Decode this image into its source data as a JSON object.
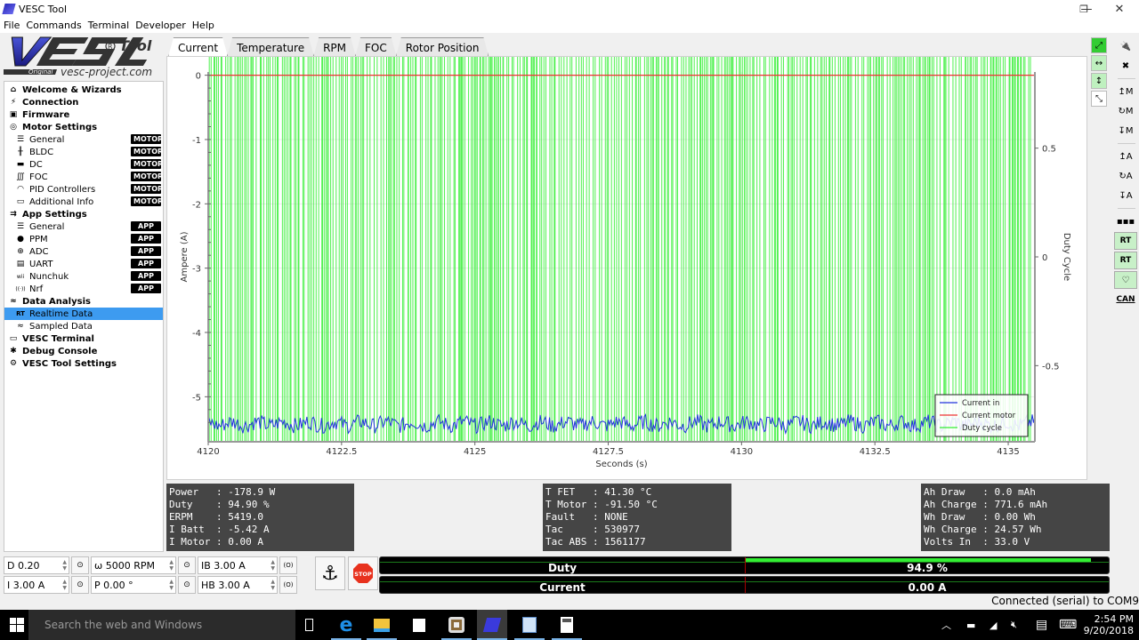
{
  "window": {
    "title": "VESC Tool",
    "controls": {
      "minimize": "—",
      "maximize": "❐",
      "close": "✕"
    }
  },
  "menu": [
    "File",
    "Commands",
    "Terminal",
    "Developer",
    "Help"
  ],
  "logo": {
    "text": "VESC Tool",
    "tagline": "Original",
    "url_text": "vesc-project.com"
  },
  "sidebar": {
    "items": [
      {
        "label": "Welcome & Wizards",
        "icon": "home-icon",
        "glyph": "⌂",
        "level": "top"
      },
      {
        "label": "Connection",
        "icon": "plug-icon",
        "glyph": "⚡",
        "level": "top"
      },
      {
        "label": "Firmware",
        "icon": "chip-icon",
        "glyph": "▣",
        "level": "top"
      },
      {
        "label": "Motor Settings",
        "icon": "motor-icon",
        "glyph": "◎",
        "level": "top"
      },
      {
        "label": "General",
        "icon": "sliders-icon",
        "glyph": "☰",
        "level": "sub",
        "badge": "MOTOR"
      },
      {
        "label": "BLDC",
        "icon": "bldc-icon",
        "glyph": "╫",
        "level": "sub",
        "badge": "MOTOR"
      },
      {
        "label": "DC",
        "icon": "battery-icon",
        "glyph": "▬",
        "level": "sub",
        "badge": "MOTOR"
      },
      {
        "label": "FOC",
        "icon": "foc-icon",
        "glyph": "∭",
        "level": "sub",
        "badge": "MOTOR"
      },
      {
        "label": "PID Controllers",
        "icon": "gauge-icon",
        "glyph": "◠",
        "level": "sub",
        "badge": "MOTOR"
      },
      {
        "label": "Additional Info",
        "icon": "info-icon",
        "glyph": "▭",
        "level": "sub",
        "badge": "MOTOR"
      },
      {
        "label": "App Settings",
        "icon": "app-icon",
        "glyph": "⇉",
        "level": "top"
      },
      {
        "label": "General",
        "icon": "sliders-icon",
        "glyph": "☰",
        "level": "sub",
        "badge": "APP"
      },
      {
        "label": "PPM",
        "icon": "gamepad-icon",
        "glyph": "●",
        "level": "sub",
        "badge": "APP"
      },
      {
        "label": "ADC",
        "icon": "adc-icon",
        "glyph": "⊕",
        "level": "sub",
        "badge": "APP"
      },
      {
        "label": "UART",
        "icon": "keyboard-icon",
        "glyph": "▤",
        "level": "sub",
        "badge": "APP"
      },
      {
        "label": "Nunchuk",
        "icon": "wii-icon",
        "glyph": "wii",
        "level": "sub",
        "badge": "APP"
      },
      {
        "label": "Nrf",
        "icon": "wireless-icon",
        "glyph": "((·))",
        "level": "sub",
        "badge": "APP"
      },
      {
        "label": "Data Analysis",
        "icon": "analysis-icon",
        "glyph": "≈",
        "level": "top"
      },
      {
        "label": "Realtime Data",
        "icon": "realtime-icon",
        "glyph": "RT",
        "level": "sub",
        "selected": true
      },
      {
        "label": "Sampled Data",
        "icon": "sampled-icon",
        "glyph": "≈",
        "level": "sub"
      },
      {
        "label": "VESC Terminal",
        "icon": "terminal-icon",
        "glyph": "▭",
        "level": "top"
      },
      {
        "label": "Debug Console",
        "icon": "bug-icon",
        "glyph": "✱",
        "level": "top"
      },
      {
        "label": "VESC Tool Settings",
        "icon": "gear-icon",
        "glyph": "⚙",
        "level": "top"
      }
    ]
  },
  "tabs": [
    {
      "label": "Current",
      "active": true
    },
    {
      "label": "Temperature"
    },
    {
      "label": "RPM"
    },
    {
      "label": "FOC"
    },
    {
      "label": "Rotor Position"
    }
  ],
  "chart_data": {
    "type": "line",
    "title": "",
    "xlabel": "Seconds (s)",
    "ylabel": "Ampere (A)",
    "y2label": "Duty Cycle",
    "xlim": [
      4120,
      4135.5
    ],
    "ylim": [
      -5.7,
      0.05
    ],
    "y2lim": [
      -0.85,
      0.85
    ],
    "xticks": [
      "4120",
      "4122.5",
      "4125",
      "4127.5",
      "4130",
      "4132.5",
      "4135"
    ],
    "xtick_values": [
      4120,
      4122.5,
      4125,
      4127.5,
      4130,
      4132.5,
      4135
    ],
    "yticks": [
      "0",
      "-1",
      "-2",
      "-3",
      "-4",
      "-5"
    ],
    "ytick_values": [
      0,
      -1,
      -2,
      -3,
      -4,
      -5
    ],
    "y2ticks": [
      "0.5",
      "0",
      "-0.5"
    ],
    "y2tick_values": [
      0.5,
      0,
      -0.5
    ],
    "grid": true,
    "legend_position": "bottom-right",
    "series": [
      {
        "name": "Current in",
        "color": "#2233dd",
        "axis": "left",
        "mean": -5.42,
        "noise": 0.12
      },
      {
        "name": "Current motor",
        "color": "#ee3333",
        "axis": "left",
        "mean": 0.0
      },
      {
        "name": "Duty cycle",
        "color": "#33ee33",
        "axis": "right",
        "levels": [
          0.949,
          -0.949
        ],
        "note": "rapidly switching between ~0.95 and off"
      }
    ]
  },
  "zoom_tools": [
    {
      "name": "zoom-both-icon",
      "glyph": "⤢",
      "active": true
    },
    {
      "name": "zoom-horizontal-icon",
      "glyph": "↔",
      "active": true
    },
    {
      "name": "zoom-vertical-icon",
      "glyph": "↕",
      "active": true
    },
    {
      "name": "rescale-icon",
      "glyph": "⤡",
      "active": false
    }
  ],
  "side_tools": [
    {
      "name": "connect-icon",
      "glyph": "🔌"
    },
    {
      "name": "disconnect-icon",
      "glyph": "✖"
    },
    {
      "name": "read-motor-config-icon",
      "glyph": "↥M"
    },
    {
      "name": "read-default-motor-config-icon",
      "glyph": "↻M"
    },
    {
      "name": "write-motor-config-icon",
      "glyph": "↧M"
    },
    {
      "name": "read-app-config-icon",
      "glyph": "↥A"
    },
    {
      "name": "read-default-app-config-icon",
      "glyph": "↻A"
    },
    {
      "name": "write-app-config-icon",
      "glyph": "↧A"
    },
    {
      "name": "motor-detect-icon",
      "glyph": "▪▪▪"
    },
    {
      "name": "realtime-data-icon",
      "glyph": "RT",
      "active": true
    },
    {
      "name": "realtime-app-icon",
      "glyph": "RT",
      "active": true
    },
    {
      "name": "keepalive-heart-icon",
      "glyph": "♡",
      "active": true
    },
    {
      "name": "can-forward-icon",
      "glyph": "CAN"
    }
  ],
  "info": {
    "left": [
      "Power   : -178.9 W",
      "Duty    : 94.90 %",
      "ERPM    : 5419.0",
      "I Batt  : -5.42 A",
      "I Motor : 0.00 A"
    ],
    "middle": [
      "T FET   : 41.30 °C",
      "T Motor : -91.50 °C",
      "Fault   : NONE",
      "Tac     : 530977",
      "Tac ABS : 1561177"
    ],
    "right": [
      "Ah Draw   : 0.0 mAh",
      "Ah Charge : 771.6 mAh",
      "Wh Draw   : 0.00 Wh",
      "Wh Charge : 24.57 Wh",
      "Volts In  : 33.0 V"
    ]
  },
  "controls": {
    "duty": "D 0.20",
    "current": "I 3.00 A",
    "rpm": "ω 5000 RPM",
    "position": "P 0.00 °",
    "brake_current": "IB 3.00 A",
    "handbrake": "HB 3.00 A",
    "play_glyph": "⊙",
    "brake_glyph": "(O)",
    "anchor_glyph": "⚓",
    "stop_label": "STOP"
  },
  "bars": {
    "duty": {
      "label": "Duty",
      "value": "94.9 %",
      "fraction": 0.949
    },
    "current": {
      "label": "Current",
      "value": "0.00 A",
      "fraction": 0.0
    }
  },
  "status": "Connected (serial) to COM9",
  "taskbar": {
    "search_placeholder": "Search the web and Windows",
    "time": "2:54 PM",
    "date": "9/20/2018"
  }
}
